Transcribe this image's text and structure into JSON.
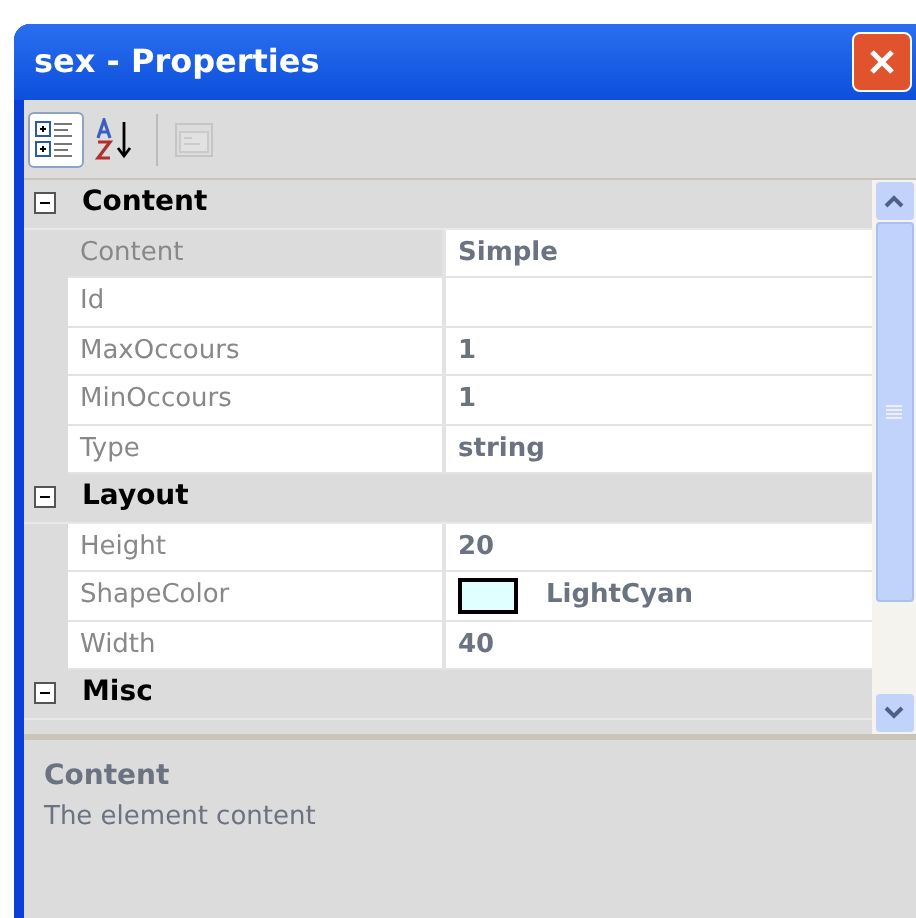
{
  "window": {
    "title": "sex - Properties"
  },
  "toolbar": [
    {
      "kind": "categorized",
      "selected": true,
      "disabled": false
    },
    {
      "kind": "alphabetical",
      "selected": false,
      "disabled": false
    },
    {
      "kind": "pages",
      "selected": false,
      "disabled": true
    }
  ],
  "categories": [
    {
      "name": "Content",
      "expanded": true,
      "properties": [
        {
          "name": "Content",
          "value": "Simple",
          "selected": true
        },
        {
          "name": "Id",
          "selected": false
        },
        {
          "name": "MaxOccours",
          "value": "1",
          "selected": false
        },
        {
          "name": "MinOccours",
          "value": "1",
          "selected": false
        },
        {
          "name": "Type",
          "value": "string",
          "selected": false
        }
      ]
    },
    {
      "name": "Layout",
      "expanded": true,
      "properties": [
        {
          "name": "Height",
          "value": "20",
          "selected": false
        },
        {
          "name": "ShapeColor",
          "value": "LightCyan",
          "color": "#e0ffff",
          "selected": false
        },
        {
          "name": "Width",
          "value": "40",
          "selected": false
        }
      ]
    },
    {
      "name": "Misc",
      "expanded": true
    }
  ],
  "description": {
    "title": "Content",
    "text": "The element content"
  }
}
